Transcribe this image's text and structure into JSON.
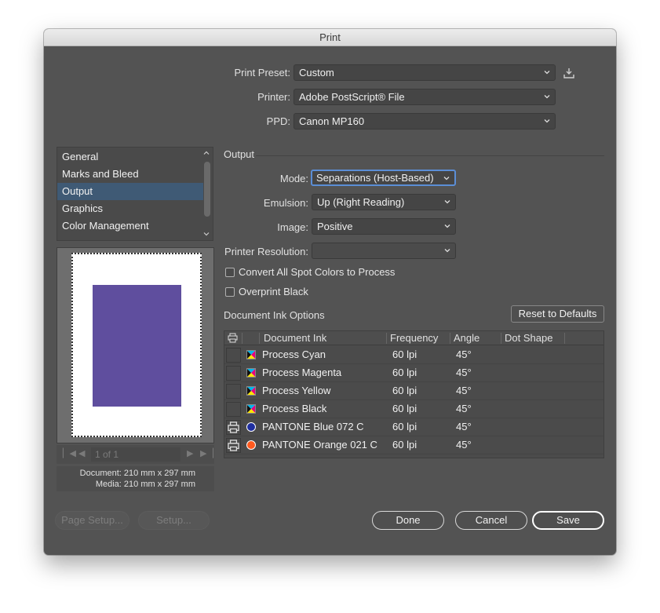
{
  "window": {
    "title": "Print"
  },
  "top": {
    "preset": {
      "label": "Print Preset:",
      "value": "Custom"
    },
    "printer": {
      "label": "Printer:",
      "value": "Adobe PostScript® File"
    },
    "ppd": {
      "label": "PPD:",
      "value": "Canon MP160"
    }
  },
  "sidebar": {
    "items": [
      {
        "label": "General"
      },
      {
        "label": "Marks and Bleed"
      },
      {
        "label": "Output",
        "active": true
      },
      {
        "label": "Graphics"
      },
      {
        "label": "Color Management"
      }
    ]
  },
  "preview": {
    "page_field": "1 of 1",
    "document": "Document: 210 mm x 297 mm",
    "media": "Media: 210 mm x 297 mm",
    "art_color": "#5f4e9e"
  },
  "output": {
    "section_title": "Output",
    "mode": {
      "label": "Mode:",
      "value": "Separations (Host-Based)"
    },
    "emulsion": {
      "label": "Emulsion:",
      "value": "Up (Right Reading)"
    },
    "image": {
      "label": "Image:",
      "value": "Positive"
    },
    "resolution": {
      "label": "Printer Resolution:",
      "value": ""
    },
    "convert_spot": {
      "label": "Convert All Spot Colors to Process",
      "checked": false
    },
    "overprint_black": {
      "label": "Overprint Black",
      "checked": false
    }
  },
  "inks": {
    "section_title": "Document Ink Options",
    "reset_button": "Reset to Defaults",
    "columns": {
      "ink": "Document Ink",
      "frequency": "Frequency",
      "angle": "Angle",
      "dot_shape": "Dot Shape"
    },
    "rows": [
      {
        "name": "Process Cyan",
        "frequency": "60 lpi",
        "angle": "45°",
        "printing": false,
        "kind": "process"
      },
      {
        "name": "Process Magenta",
        "frequency": "60 lpi",
        "angle": "45°",
        "printing": false,
        "kind": "process"
      },
      {
        "name": "Process Yellow",
        "frequency": "60 lpi",
        "angle": "45°",
        "printing": false,
        "kind": "process"
      },
      {
        "name": "Process Black",
        "frequency": "60 lpi",
        "angle": "45°",
        "printing": false,
        "kind": "process"
      },
      {
        "name": "PANTONE Blue 072 C",
        "frequency": "60 lpi",
        "angle": "45°",
        "printing": true,
        "kind": "spot",
        "color": "#1f2fa0"
      },
      {
        "name": "PANTONE Orange 021 C",
        "frequency": "60 lpi",
        "angle": "45°",
        "printing": true,
        "kind": "spot",
        "color": "#ff5a1f"
      }
    ]
  },
  "buttons": {
    "page_setup": "Page Setup...",
    "setup": "Setup...",
    "done": "Done",
    "cancel": "Cancel",
    "save": "Save"
  }
}
